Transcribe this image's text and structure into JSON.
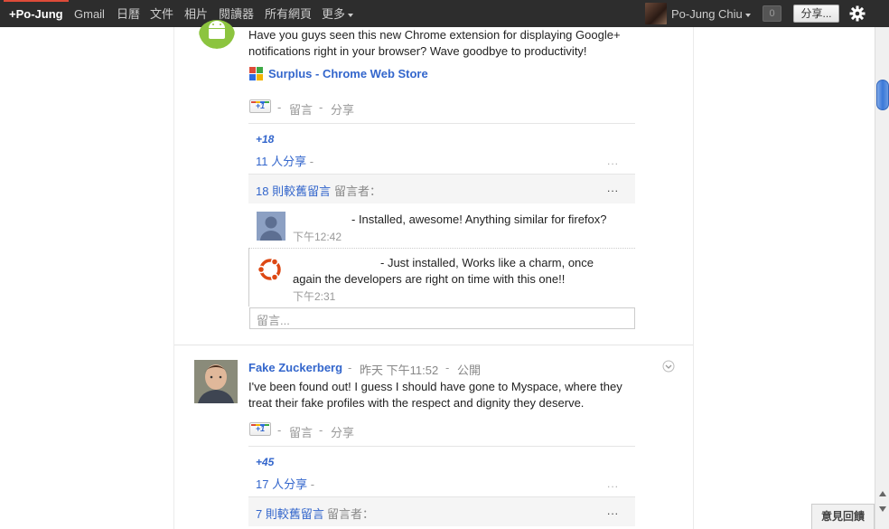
{
  "gbar": {
    "items": [
      "+Po-Jung",
      "Gmail",
      "日曆",
      "文件",
      "相片",
      "閱讀器",
      "所有網頁",
      "更多"
    ],
    "user_name": "Po-Jung Chiu",
    "notif_count": "0",
    "share_label": "分享..."
  },
  "post1": {
    "text": "Have you guys seen this new Chrome extension for displaying Google+ notifications right in your browser? Wave goodbye to productivity!",
    "link_label": "Surplus - Chrome Web Store",
    "actions": {
      "comment": "留言",
      "share": "分享",
      "sep": "-"
    },
    "plus_count": "+18",
    "share_count": "11 人分享",
    "older_comments": "18 則較舊留言",
    "commenters_label": "留言者：",
    "ellipsis": "...",
    "comments": [
      {
        "text": "- Installed, awesome! Anything similar for firefox?",
        "time": "下午12:42"
      },
      {
        "text_line1": "- Just installed, Works like a charm, once",
        "text_line2": "again the developers are right on time with this one!!",
        "time": "下午2:31"
      }
    ],
    "comment_placeholder": "留言..."
  },
  "post2": {
    "author": "Fake Zuckerberg",
    "time": "昨天 下午11:52",
    "visibility": "公開",
    "text": "I've been found out! I guess I should have gone to Myspace, where they treat their fake profiles with the respect and dignity they deserve.",
    "actions": {
      "comment": "留言",
      "share": "分享",
      "sep": "-"
    },
    "plus_count": "+45",
    "share_count": "17 人分享",
    "older_comments": "7 則較舊留言",
    "commenters_label": "留言者：",
    "ellipsis": "..."
  },
  "plusone_label": "+1",
  "feedback_label": "意見回饋",
  "colors": {
    "link": "#3366cc",
    "bar": "#2d2d2d",
    "accent_red": "#dd4b39"
  },
  "icons": [
    "android-avatar",
    "chrome-store-icon",
    "ubuntu-avatar",
    "default-user-avatar",
    "gear-icon",
    "post-menu-chevron-icon",
    "scroll-up-arrow",
    "scroll-down-arrow"
  ]
}
